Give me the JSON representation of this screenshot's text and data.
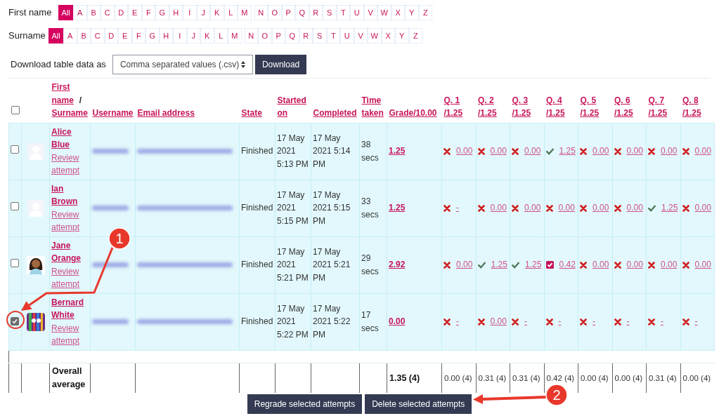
{
  "filters": [
    {
      "label": "First name",
      "groups": [
        [
          {
            "text": "All",
            "selected": true
          },
          {
            "text": "A",
            "selected": false
          },
          {
            "text": "B",
            "selected": false
          },
          {
            "text": "C",
            "selected": false
          },
          {
            "text": "D",
            "selected": false
          },
          {
            "text": "E",
            "selected": false
          },
          {
            "text": "F",
            "selected": false
          },
          {
            "text": "G",
            "selected": false
          },
          {
            "text": "H",
            "selected": false
          },
          {
            "text": "I",
            "selected": false
          },
          {
            "text": "J",
            "selected": false
          },
          {
            "text": "K",
            "selected": false
          },
          {
            "text": "L",
            "selected": false
          },
          {
            "text": "M",
            "selected": false
          }
        ],
        [
          {
            "text": "N",
            "selected": false
          },
          {
            "text": "O",
            "selected": false
          },
          {
            "text": "P",
            "selected": false
          },
          {
            "text": "Q",
            "selected": false
          },
          {
            "text": "R",
            "selected": false
          },
          {
            "text": "S",
            "selected": false
          },
          {
            "text": "T",
            "selected": false
          },
          {
            "text": "U",
            "selected": false
          },
          {
            "text": "V",
            "selected": false
          },
          {
            "text": "W",
            "selected": false
          },
          {
            "text": "X",
            "selected": false
          },
          {
            "text": "Y",
            "selected": false
          },
          {
            "text": "Z",
            "selected": false
          }
        ]
      ]
    },
    {
      "label": "Surname",
      "groups": [
        [
          {
            "text": "All",
            "selected": true
          },
          {
            "text": "A",
            "selected": false
          },
          {
            "text": "B",
            "selected": false
          },
          {
            "text": "C",
            "selected": false
          },
          {
            "text": "D",
            "selected": false
          },
          {
            "text": "E",
            "selected": false
          },
          {
            "text": "F",
            "selected": false
          },
          {
            "text": "G",
            "selected": false
          },
          {
            "text": "H",
            "selected": false
          },
          {
            "text": "I",
            "selected": false
          },
          {
            "text": "J",
            "selected": false
          },
          {
            "text": "K",
            "selected": false
          },
          {
            "text": "L",
            "selected": false
          },
          {
            "text": "M",
            "selected": false
          }
        ],
        [
          {
            "text": "N",
            "selected": false
          },
          {
            "text": "O",
            "selected": false
          },
          {
            "text": "P",
            "selected": false
          },
          {
            "text": "Q",
            "selected": false
          },
          {
            "text": "R",
            "selected": false
          },
          {
            "text": "S",
            "selected": false
          },
          {
            "text": "T",
            "selected": false
          },
          {
            "text": "U",
            "selected": false
          },
          {
            "text": "V",
            "selected": false
          },
          {
            "text": "W",
            "selected": false
          },
          {
            "text": "X",
            "selected": false
          },
          {
            "text": "Y",
            "selected": false
          },
          {
            "text": "Z",
            "selected": false
          }
        ]
      ]
    }
  ],
  "download": {
    "label": "Download table data as",
    "format": "Comma separated values (.csv)",
    "button": "Download"
  },
  "table": {
    "select_all": {
      "checked": false
    },
    "name_column": {
      "first": "First name",
      "separator": "/",
      "second": "Surname"
    },
    "columns": [
      "Username",
      "Email address",
      "State",
      "Started on",
      "Completed",
      "Time taken",
      "Grade/10.00"
    ],
    "questions": [
      {
        "title": "Q. 1",
        "max": "/1.25"
      },
      {
        "title": "Q. 2",
        "max": "/1.25"
      },
      {
        "title": "Q. 3",
        "max": "/1.25"
      },
      {
        "title": "Q. 4",
        "max": "/1.25"
      },
      {
        "title": "Q. 5",
        "max": "/1.25"
      },
      {
        "title": "Q. 6",
        "max": "/1.25"
      },
      {
        "title": "Q. 7",
        "max": "/1.25"
      },
      {
        "title": "Q. 8",
        "max": "/1.25"
      }
    ],
    "rows": [
      {
        "checked": false,
        "avatar": {
          "kind": "default"
        },
        "first": "Alice",
        "last": "Blue",
        "review": "Review attempt",
        "state": "Finished",
        "started": "17 May 2021 5:13 PM",
        "completed": "17 May 2021 5:14 PM",
        "time": "38 secs",
        "grade": "1.25",
        "answers": [
          {
            "kind": "wrong",
            "value": "0.00"
          },
          {
            "kind": "wrong",
            "value": "0.00"
          },
          {
            "kind": "wrong",
            "value": "0.00"
          },
          {
            "kind": "correct",
            "value": "1.25"
          },
          {
            "kind": "wrong",
            "value": "0.00"
          },
          {
            "kind": "wrong",
            "value": "0.00"
          },
          {
            "kind": "wrong",
            "value": "0.00"
          },
          {
            "kind": "wrong",
            "value": "0.00"
          }
        ]
      },
      {
        "checked": false,
        "avatar": {
          "kind": "default"
        },
        "first": "Ian",
        "last": "Brown",
        "review": "Review attempt",
        "state": "Finished",
        "started": "17 May 2021 5:15 PM",
        "completed": "17 May 2021 5:15 PM",
        "time": "33 secs",
        "grade": "1.25",
        "answers": [
          {
            "kind": "wrong",
            "value": "-"
          },
          {
            "kind": "wrong",
            "value": "0.00"
          },
          {
            "kind": "wrong",
            "value": "0.00"
          },
          {
            "kind": "wrong",
            "value": "0.00"
          },
          {
            "kind": "wrong",
            "value": "0.00"
          },
          {
            "kind": "wrong",
            "value": "0.00"
          },
          {
            "kind": "correct",
            "value": "1.25"
          },
          {
            "kind": "wrong",
            "value": "0.00"
          }
        ]
      },
      {
        "checked": false,
        "first": "Jane",
        "last": "Orange",
        "review": "Review attempt",
        "state": "Finished",
        "started": "17 May 2021 5:21 PM",
        "completed": "17 May 2021 5:21 PM",
        "time": "29 secs",
        "grade": "2.92",
        "answers": [
          {
            "kind": "wrong",
            "value": "0.00"
          },
          {
            "kind": "correct",
            "value": "1.25"
          },
          {
            "kind": "correct",
            "value": "1.25"
          },
          {
            "kind": "partial",
            "value": "0.42"
          },
          {
            "kind": "wrong",
            "value": "0.00"
          },
          {
            "kind": "wrong",
            "value": "0.00"
          },
          {
            "kind": "wrong",
            "value": "0.00"
          },
          {
            "kind": "wrong",
            "value": "0.00"
          }
        ]
      },
      {
        "checked": true,
        "first": "Bernard",
        "last": "White",
        "review": "Review attempt",
        "state": "Finished",
        "started": "17 May 2021 5:22 PM",
        "completed": "17 May 2021 5:22 PM",
        "time": "17 secs",
        "grade": "0.00",
        "answers": [
          {
            "kind": "wrong",
            "value": "-"
          },
          {
            "kind": "wrong",
            "value": "0.00"
          },
          {
            "kind": "wrong",
            "value": "-"
          },
          {
            "kind": "wrong",
            "value": "-"
          },
          {
            "kind": "wrong",
            "value": "-"
          },
          {
            "kind": "wrong",
            "value": "-"
          },
          {
            "kind": "wrong",
            "value": "-"
          },
          {
            "kind": "wrong",
            "value": "-"
          }
        ]
      }
    ],
    "average": {
      "label": "Overall average",
      "grade": "1.35 (4)",
      "questions": [
        "0.00 (4)",
        "0.31 (4)",
        "0.31 (4)",
        "0.42 (4)",
        "0.00 (4)",
        "0.00 (4)",
        "0.31 (4)",
        "0.00 (4)"
      ]
    }
  },
  "actions": [
    "Regrade selected attempts",
    "Delete selected attempts"
  ],
  "callouts": [
    {
      "label": "1"
    },
    {
      "label": "2"
    }
  ]
}
